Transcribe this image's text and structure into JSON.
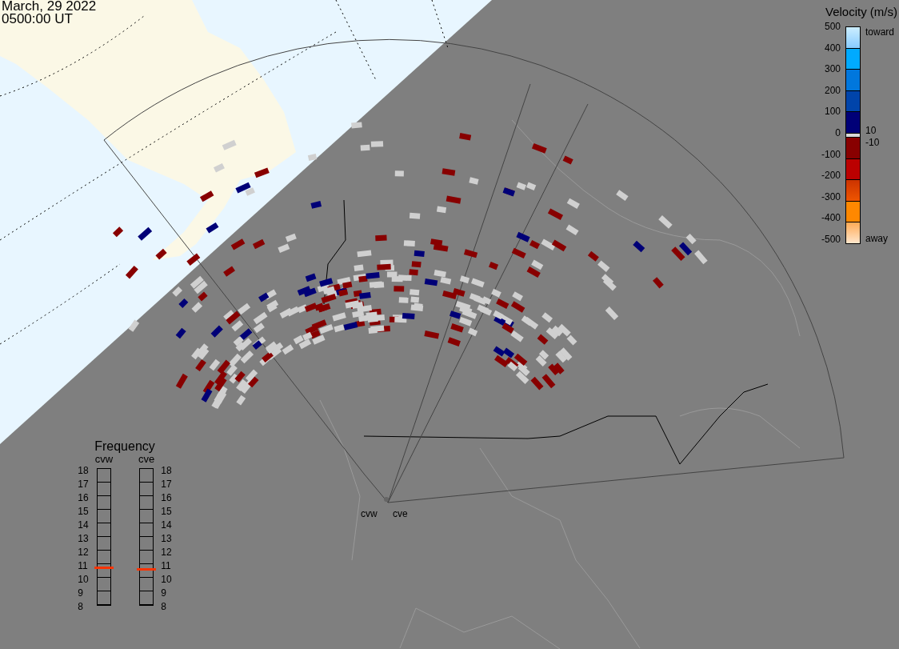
{
  "header": {
    "date": "March, 29 2022",
    "time": "0500:00 UT"
  },
  "velocity_legend": {
    "title": "Velocity (m/s)",
    "ticks": [
      "500",
      "400",
      "300",
      "200",
      "100",
      "0",
      "-100",
      "-200",
      "-300",
      "-400",
      "-500"
    ],
    "toward_label": "toward",
    "upper_threshold": "10",
    "lower_threshold": "-10",
    "away_label": "away"
  },
  "frequency_legend": {
    "title": "Frequency",
    "left_ticks": [
      "18",
      "17",
      "16",
      "15",
      "14",
      "13",
      "12",
      "11",
      "10",
      "9",
      "8"
    ],
    "right_ticks": [
      "18",
      "17",
      "16",
      "15",
      "14",
      "13",
      "12",
      "11",
      "10",
      "9",
      "8"
    ],
    "radars": [
      {
        "name": "cvw",
        "level": 0.27
      },
      {
        "name": "cve",
        "level": 0.26
      }
    ]
  },
  "map": {
    "site_labels": [
      "cvw",
      "cve"
    ]
  }
}
